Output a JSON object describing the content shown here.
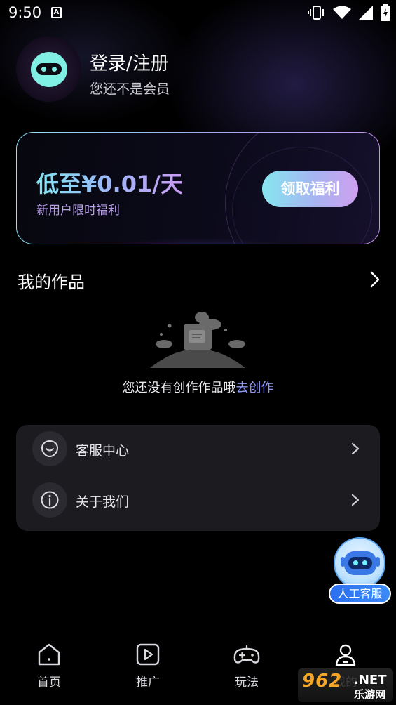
{
  "status_bar": {
    "time": "9:50",
    "notification_glyph": "A"
  },
  "profile": {
    "title": "登录/注册",
    "subtitle": "您还不是会员"
  },
  "promo": {
    "price_text": "低至¥0.01/天",
    "subtitle": "新用户限时福利",
    "button_label": "领取福利"
  },
  "works": {
    "title": "我的作品",
    "empty_text": "您还没有创作作品哦",
    "empty_link": "去创作"
  },
  "menu": {
    "items": [
      {
        "label": "客服中心",
        "icon": "customer-service-icon"
      },
      {
        "label": "关于我们",
        "icon": "info-icon"
      }
    ]
  },
  "floating_support": {
    "label": "人工客服"
  },
  "bottom_nav": {
    "items": [
      {
        "label": "首页",
        "icon": "home-icon"
      },
      {
        "label": "推广",
        "icon": "play-icon"
      },
      {
        "label": "玩法",
        "icon": "gamepad-icon"
      },
      {
        "label": "我的",
        "icon": "user-icon"
      }
    ]
  },
  "watermark": {
    "number": "962",
    "net": ".NET",
    "cn": "乐游网"
  },
  "colors": {
    "accent_cyan": "#7fe6f2",
    "accent_purple": "#c99cf3",
    "link": "#8f98f6",
    "card_bg": "#1c1c20"
  }
}
